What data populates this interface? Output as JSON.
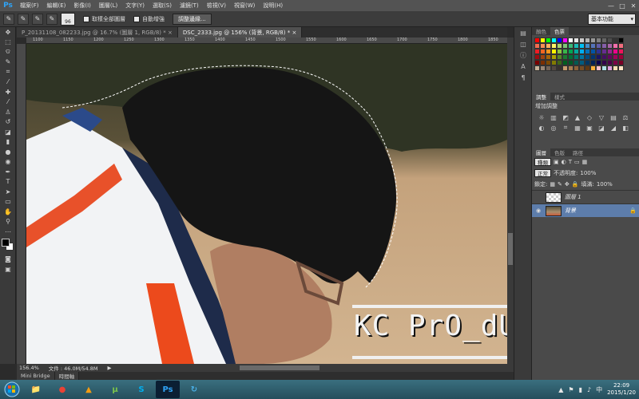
{
  "app": {
    "logo": "Ps"
  },
  "menu": [
    "檔案(F)",
    "編輯(E)",
    "影像(I)",
    "圖層(L)",
    "文字(Y)",
    "選取(S)",
    "濾鏡(T)",
    "檢視(V)",
    "視窗(W)",
    "說明(H)"
  ],
  "window_controls": {
    "minimize": "—",
    "maximize": "□",
    "close": "✕"
  },
  "options": {
    "brush_size": "96",
    "sample_all_layers": "取樣全部圖層",
    "auto_enhance": "自動增強",
    "refine_edge": "調整邊緣...",
    "workspace": "基本功能"
  },
  "tabs": [
    {
      "label": "P_20131108_082233.jpg @ 16.7% (圖層 1, RGB/8) *",
      "close": "×"
    },
    {
      "label": "DSC_2333.jpg @ 156% (背景, RGB/8) *",
      "close": "×"
    }
  ],
  "ruler_ticks": [
    "1100",
    "1150",
    "1200",
    "1250",
    "1300",
    "1350",
    "1400",
    "1450",
    "1500",
    "1550",
    "1600",
    "1650",
    "1700",
    "1750",
    "1800",
    "1850"
  ],
  "canvas": {
    "watermark": "KC PrO_dUctiON"
  },
  "status": {
    "zoom": "156.4%",
    "doc": "文件 : 46.0M/54.8M",
    "arrow": "▶"
  },
  "bottom_tabs": [
    "Mini Bridge",
    "時間軸"
  ],
  "panels": {
    "color_tabs": [
      "顏色",
      "色票"
    ],
    "adjust_tabs": [
      "調整",
      "樣式"
    ],
    "adjust_title": "增加調整",
    "layer_tabs": [
      "圖層",
      "色版",
      "路徑"
    ],
    "kind": "種類",
    "blend": "正常",
    "opacity_label": "不透明度:",
    "opacity": "100%",
    "lock_label": "鎖定:",
    "fill_label": "填滿:",
    "fill": "100%",
    "layers": [
      {
        "name": "圖層 1",
        "selected": false
      },
      {
        "name": "背景",
        "selected": true
      }
    ]
  },
  "swatch_colors": [
    "#ff0000",
    "#ffff00",
    "#00ff00",
    "#00ffff",
    "#0000ff",
    "#ff00ff",
    "#ffffff",
    "#e6e6e6",
    "#cccccc",
    "#b3b3b3",
    "#999999",
    "#808080",
    "#666666",
    "#4d4d4d",
    "#333333",
    "#000000",
    "#f26c4f",
    "#f68e55",
    "#fbaf5c",
    "#fff467",
    "#acd372",
    "#7cc576",
    "#3bb878",
    "#1abbb4",
    "#00bff3",
    "#438cca",
    "#5574b9",
    "#605ca8",
    "#855fa8",
    "#a763a8",
    "#f06ea9",
    "#f26d7d",
    "#ed1c24",
    "#f26522",
    "#f7941d",
    "#fff200",
    "#8dc63f",
    "#39b54a",
    "#00a651",
    "#00a99d",
    "#00aeef",
    "#0072bc",
    "#0054a6",
    "#2e3192",
    "#662d91",
    "#92278f",
    "#ec008c",
    "#ed145b",
    "#9e0b0f",
    "#a0410d",
    "#a36209",
    "#aba000",
    "#598527",
    "#1a7b30",
    "#007236",
    "#00746b",
    "#0076a3",
    "#004b80",
    "#003471",
    "#1b1464",
    "#440e62",
    "#630460",
    "#9e005d",
    "#9e0039",
    "#790000",
    "#7b2e00",
    "#7d4900",
    "#827b00",
    "#406618",
    "#005e20",
    "#005826",
    "#005952",
    "#005b7f",
    "#003663",
    "#002157",
    "#0d004c",
    "#32004b",
    "#4b0049",
    "#7b0046",
    "#7a0026",
    "#c7b299",
    "#998675",
    "#736357",
    "#534741",
    "#37302d",
    "#c69c6d",
    "#a67c52",
    "#8c6239",
    "#754c24",
    "#603913",
    "#fbb03b",
    "#ffc0cb",
    "#b0e0e6",
    "#dda0dd",
    "#f5deb3",
    "#ffe4c4"
  ],
  "adjust_icons": [
    "☼",
    "▥",
    "◩",
    "▲",
    "◇",
    "▽",
    "▤",
    "⚖",
    "◐",
    "◎",
    "⌗",
    "▦",
    "▣",
    "◪",
    "◢",
    "◧"
  ],
  "taskbar": {
    "apps": [
      "📁",
      "●",
      "▲",
      "μ",
      "S",
      "Ps",
      "↻"
    ],
    "tray": [
      "▲",
      "⚑",
      "▮",
      "♪",
      "中"
    ],
    "time": "22:09",
    "date": "2015/1/20"
  }
}
